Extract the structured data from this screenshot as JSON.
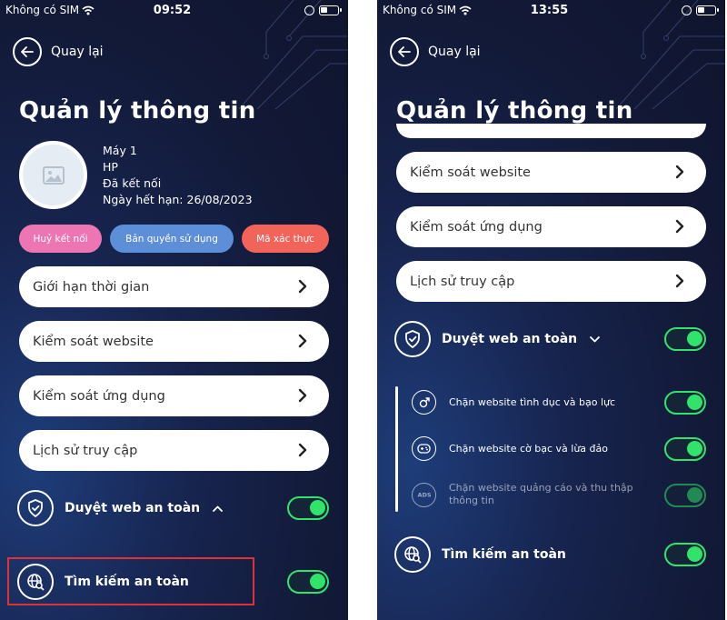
{
  "left": {
    "status": {
      "carrier": "Không có SIM",
      "time": "09:52"
    },
    "back_label": "Quay lại",
    "title": "Quản lý thông tin",
    "device": {
      "name": "Máy 1",
      "model": "HP",
      "status": "Đã kết nối",
      "expiry": "Ngày hết hạn: 26/08/2023"
    },
    "actions": {
      "disconnect": "Huỷ kết nối",
      "license": "Bản quyền sử dụng",
      "auth_code": "Mã xác thực"
    },
    "menu": [
      "Giới hạn thời gian",
      "Kiểm soát website",
      "Kiểm soát ứng dụng",
      "Lịch sử truy cập"
    ],
    "safe_browsing": {
      "label": "Duyệt web an toàn",
      "enabled": true
    },
    "safe_search": {
      "label": "Tìm kiếm an toàn",
      "enabled": true
    }
  },
  "right": {
    "status": {
      "carrier": "Không có SIM",
      "time": "13:55"
    },
    "back_label": "Quay lại",
    "title": "Quản lý thông tin",
    "menu": [
      "Kiểm soát website",
      "Kiểm soát ứng dụng",
      "Lịch sử truy cập"
    ],
    "safe_browsing": {
      "label": "Duyệt web an toàn",
      "enabled": true,
      "items": [
        {
          "label": "Chặn website tình dục và bạo lực",
          "icon": "gender-icon",
          "enabled": true
        },
        {
          "label": "Chặn website cờ bạc và lừa đảo",
          "icon": "gamepad-icon",
          "enabled": true
        },
        {
          "label": "Chặn website quảng cáo và thu thập thông tin",
          "icon": "ads-icon",
          "enabled": true
        }
      ]
    },
    "safe_search": {
      "label": "Tìm kiếm an toàn",
      "enabled": true
    }
  },
  "colors": {
    "background": "#121936",
    "toggle_on": "#2fe36b",
    "pill_pink": "#ee75b4",
    "pill_blue": "#5d8fd9",
    "pill_red": "#f2635a",
    "highlight": "#e0313b"
  }
}
